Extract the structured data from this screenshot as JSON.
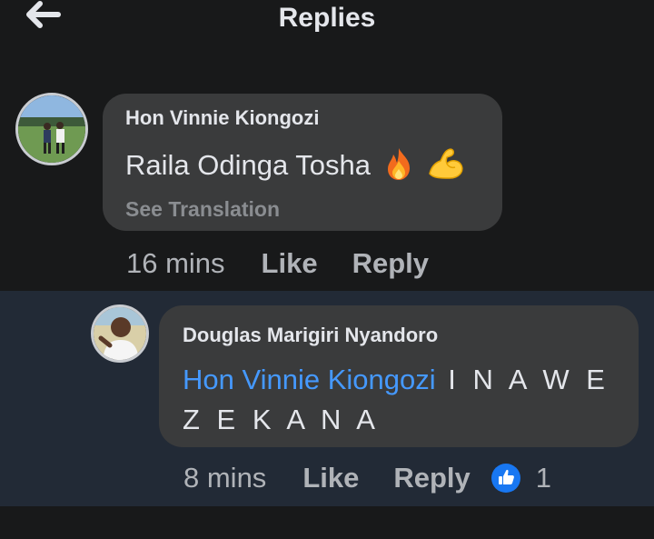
{
  "header": {
    "title": "Replies",
    "back_icon": "arrow-left-icon"
  },
  "comments": [
    {
      "author": "Hon Vinnie Kiongozi",
      "text": "Raila Odinga Tosha",
      "emojis": [
        "fire-emoji",
        "flexed-biceps-emoji"
      ],
      "see_translation": "See Translation",
      "time": "16 mins",
      "like_label": "Like",
      "reply_label": "Reply"
    },
    {
      "author": "Douglas Marigiri Nyandoro",
      "mention": "Hon Vinnie Kiongozi",
      "text": "I N A W E Z E K A N A",
      "time": "8 mins",
      "like_label": "Like",
      "reply_label": "Reply",
      "reaction_icon": "thumbs-up-icon",
      "reaction_count": "1"
    }
  ],
  "colors": {
    "background": "#18191a",
    "bubble": "#3a3b3c",
    "highlight": "#222a36",
    "mention": "#4599ff",
    "secondary_text": "#b0b3b8",
    "like_blue": "#1877f2"
  }
}
